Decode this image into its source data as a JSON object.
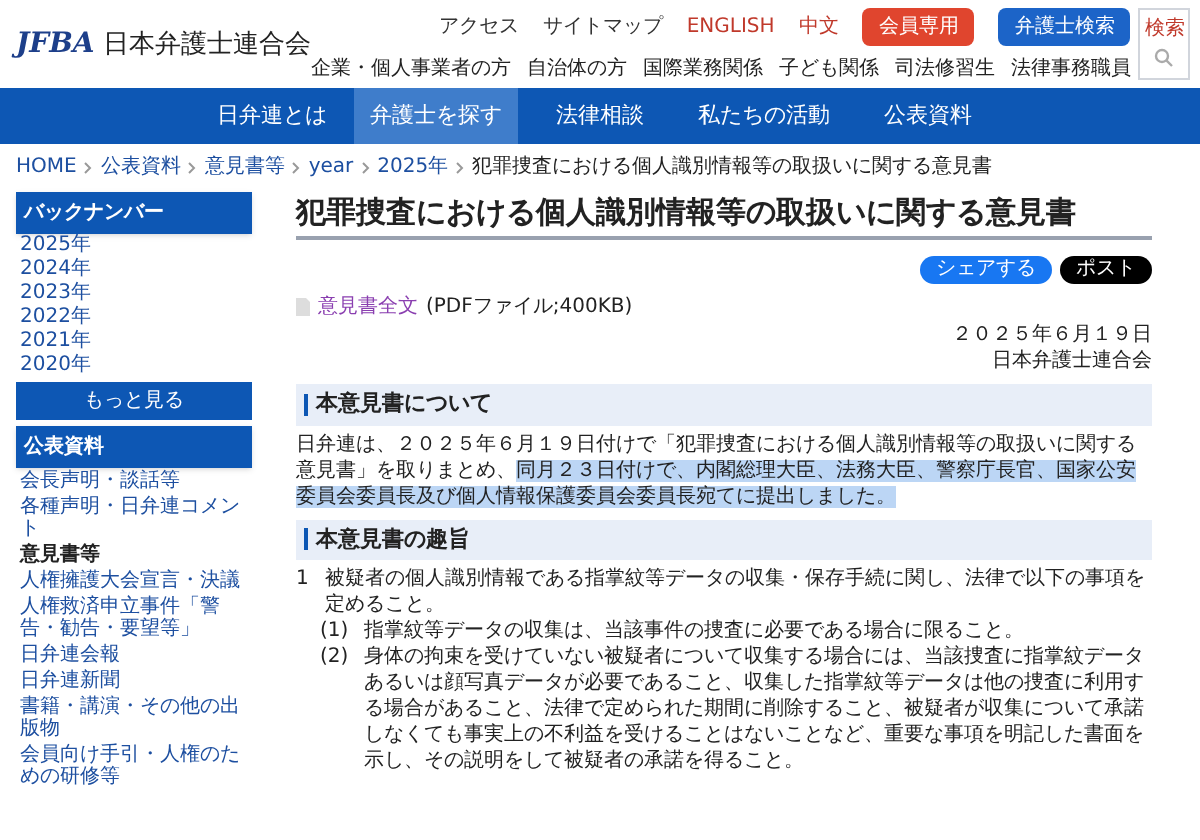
{
  "header": {
    "logo_mark": "JFBA",
    "logo_text": "日本弁護士連合会",
    "top_links": [
      "アクセス",
      "サイトマップ",
      "ENGLISH",
      "中文"
    ],
    "buttons": [
      {
        "label": "会員専用",
        "kind": "member"
      },
      {
        "label": "弁護士検索",
        "kind": "search"
      }
    ],
    "audience_links": [
      "企業・個人事業者の方",
      "自治体の方",
      "国際業務関係",
      "子ども関係",
      "司法修習生",
      "法律事務職員"
    ],
    "search_label": "検索"
  },
  "nav": [
    {
      "label": "日弁連とは",
      "selected": false
    },
    {
      "label": "弁護士を探す",
      "selected": true
    },
    {
      "label": "法律相談",
      "selected": false
    },
    {
      "label": "私たちの活動",
      "selected": false
    },
    {
      "label": "公表資料",
      "selected": false
    }
  ],
  "breadcrumb": [
    "HOME",
    "公表資料",
    "意見書等",
    "year",
    "2025年",
    "犯罪捜査における個人識別情報等の取扱いに関する意見書"
  ],
  "sidebar": {
    "backnumber_title": "バックナンバー",
    "years": [
      "2025年",
      "2024年",
      "2023年",
      "2022年",
      "2021年",
      "2020年"
    ],
    "more": "もっと見る",
    "section_title": "公表資料",
    "items": [
      {
        "label": "会長声明・談話等",
        "current": false
      },
      {
        "label": "各種声明・日弁連コメント",
        "current": false
      },
      {
        "label": "意見書等",
        "current": true
      },
      {
        "label": "人権擁護大会宣言・決議",
        "current": false
      },
      {
        "label": "人権救済申立事件「警告・勧告・要望等」",
        "current": false
      },
      {
        "label": "日弁連会報",
        "current": false
      },
      {
        "label": "日弁連新聞",
        "current": false
      },
      {
        "label": "書籍・講演・その他の出版物",
        "current": false
      },
      {
        "label": "会員向け手引・人権のための研修等",
        "current": false
      }
    ]
  },
  "article": {
    "title": "犯罪捜査における個人識別情報等の取扱いに関する意見書",
    "share": [
      {
        "label": "シェアする",
        "kind": "facebook"
      },
      {
        "label": "ポスト",
        "kind": "x"
      }
    ],
    "pdf_link": "意見書全文",
    "pdf_note": "(PDFファイル;400KB)",
    "date": "２０２５年６月１９日",
    "author": "日本弁護士連合会",
    "sections": [
      {
        "heading": "本意見書について",
        "paragraph": {
          "text": "日弁連は、２０２５年６月１９日付けで「犯罪捜査における個人識別情報等の取扱いに関する意見書」を取りまとめ、",
          "highlighted": "同月２３日付けで、内閣総理大臣、法務大臣、警察庁長官、国家公安委員会委員長及び個人情報保護委員会委員長宛てに提出しました。"
        }
      },
      {
        "heading": "本意見書の趣旨",
        "list": [
          {
            "marker": "1",
            "text": "被疑者の個人識別情報である指掌紋等データの収集・保存手続に関し、法律で以下の事項を定めること。",
            "children": [
              {
                "marker": "(1)",
                "text": "指掌紋等データの収集は、当該事件の捜査に必要である場合に限ること。"
              },
              {
                "marker": "(2)",
                "text": "身体の拘束を受けていない被疑者について収集する場合には、当該捜査に指掌紋データあるいは顔写真データが必要であること、収集した指掌紋等データは他の捜査に利用する場合があること、法律で定められた期間に削除すること、被疑者が収集について承諾しなくても事実上の不利益を受けることはないことなど、重要な事項を明記した書面を示し、その説明をして被疑者の承諾を得ること。"
              }
            ]
          }
        ]
      }
    ]
  }
}
